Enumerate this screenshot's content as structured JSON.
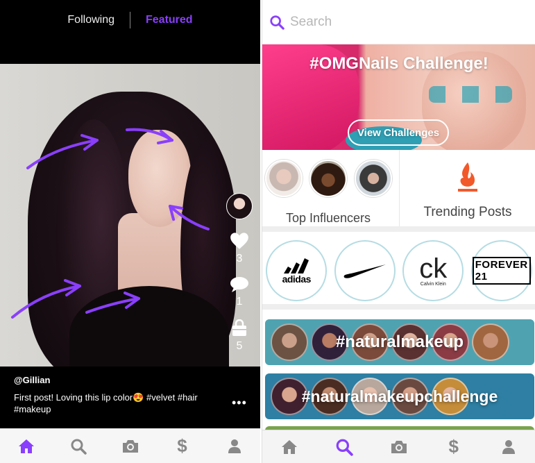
{
  "feed": {
    "tabs": {
      "following": "Following",
      "featured": "Featured"
    },
    "post": {
      "username": "@Gillian",
      "caption": "First post! Loving this lip color😍 #velvet #hair #makeup",
      "likes": "3",
      "comments": "1",
      "shop": "5"
    },
    "nav": [
      "home-icon",
      "search-icon",
      "camera-icon",
      "dollar-icon",
      "profile-icon"
    ],
    "accent": "#8a3ffc"
  },
  "discover": {
    "search": {
      "placeholder": "Search"
    },
    "banner": {
      "title": "#OMGNails Challenge!",
      "button": "View Challenges"
    },
    "top_influencers": {
      "label": "Top Influencers"
    },
    "trending": {
      "label": "Trending Posts"
    },
    "brands": [
      "adidas",
      "Nike",
      "Calvin Klein",
      "FOREVER 21"
    ],
    "hashtags": [
      {
        "tag": "#naturalmakeup",
        "color": "#4fa3b1"
      },
      {
        "tag": "#naturalmakeupchallenge",
        "color": "#2e7fa3"
      }
    ],
    "nav": [
      "home-icon",
      "search-icon",
      "camera-icon",
      "dollar-icon",
      "profile-icon"
    ],
    "active_nav": "search-icon"
  }
}
